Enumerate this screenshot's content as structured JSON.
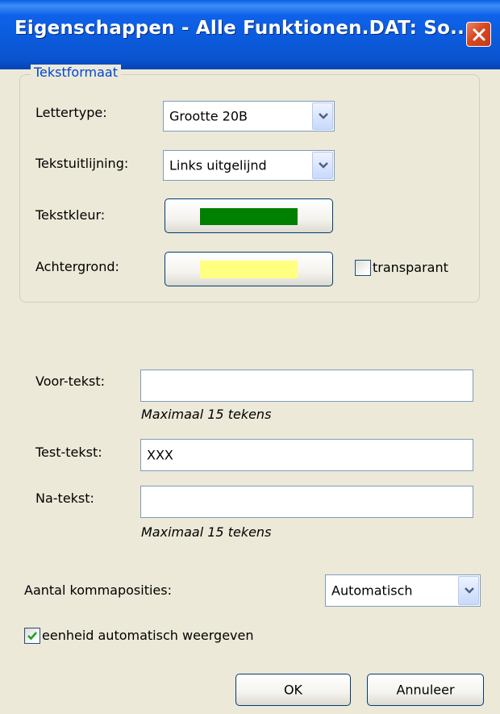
{
  "window": {
    "title": "Eigenschappen - Alle Funktionen.DAT: So..."
  },
  "groupbox": {
    "label": "Tekstformaat"
  },
  "font": {
    "label": "Lettertype:",
    "value": "Grootte 20B"
  },
  "alignment": {
    "label": "Tekstuitlijning:",
    "value": "Links uitgelijnd"
  },
  "text_color": {
    "label": "Tekstkleur:",
    "color": "#008000"
  },
  "background": {
    "label": "Achtergrond:",
    "color": "#ffff80"
  },
  "transparent": {
    "label": "transparant",
    "checked": false
  },
  "pre_text": {
    "label": "Voor-tekst:",
    "value": "",
    "hint": "Maximaal 15 tekens"
  },
  "test_text": {
    "label": "Test-tekst:",
    "value": "XXX"
  },
  "post_text": {
    "label": "Na-tekst:",
    "value": "",
    "hint": "Maximaal 15 tekens"
  },
  "decimals": {
    "label": "Aantal kommaposities:",
    "value": "Automatisch"
  },
  "auto_unit": {
    "label": "eenheid automatisch weergeven",
    "checked": true
  },
  "buttons": {
    "ok": "OK",
    "cancel": "Annuleer"
  }
}
